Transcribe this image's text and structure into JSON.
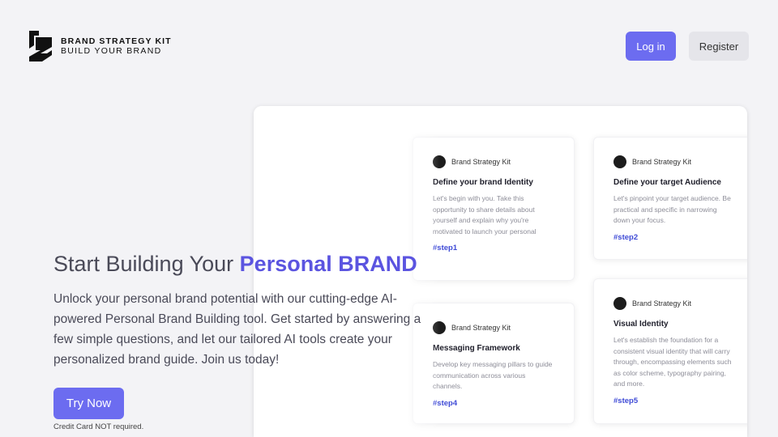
{
  "header": {
    "logo_line1": "BRAND STRATEGY KIT",
    "logo_line2": "BUILD YOUR BRAND",
    "login_label": "Log in",
    "register_label": "Register"
  },
  "hero": {
    "title_prefix": "Start Building Your ",
    "title_accent": "Personal BRAND",
    "description": "Unlock your personal brand potential with our cutting-edge AI-powered Personal Brand Building tool. Get started by answering a few simple questions, and let our tailored AI tools create your personalized brand guide. Join us today!",
    "cta_label": "Try Now",
    "note": "Credit Card NOT required."
  },
  "cards": [
    {
      "brand": "Brand Strategy Kit",
      "title": "Define your brand Identity",
      "body": "Let's begin with you. Take this opportunity to share details about yourself and explain why you're motivated to launch your personal brand.",
      "tag": "#step1"
    },
    {
      "brand": "Brand Strategy Kit",
      "title": "Define your target Audience",
      "body": "Let's pinpoint your target audience. Be practical and specific in narrowing down your focus.",
      "tag": "#step2"
    },
    {
      "brand": "Brand Strategy Kit",
      "title": "Messaging Framework",
      "body": "Develop key messaging pillars to guide communication across various channels.",
      "tag": "#step4"
    },
    {
      "brand": "Brand Strategy Kit",
      "title": "Visual Identity",
      "body": "Let's establish the foundation for a consistent visual identity that will carry through, encompassing elements such as color scheme, typography pairing, and more.",
      "tag": "#step5"
    }
  ],
  "colors": {
    "accent": "#6c6cf0",
    "accent_text": "#5b54e0",
    "tag": "#3f4bd6",
    "background": "#f3f3f6"
  }
}
